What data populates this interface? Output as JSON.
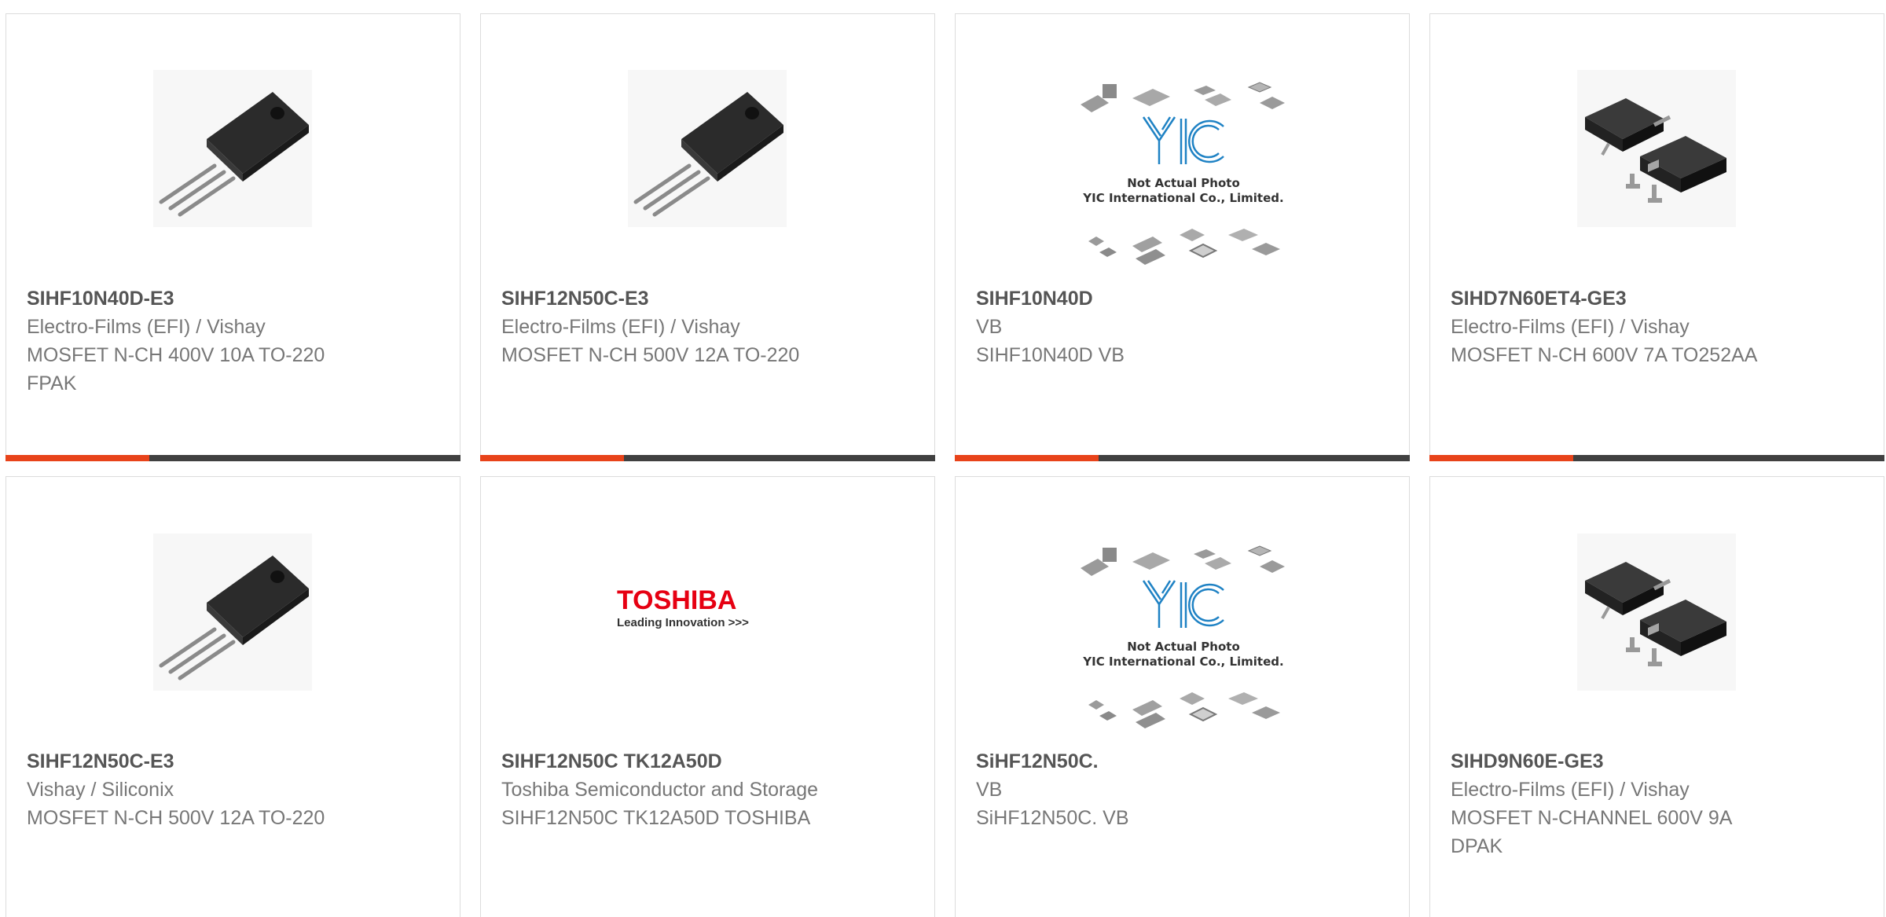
{
  "colors": {
    "accent": "#e8431a",
    "bar": "#404040",
    "part_text": "#555555",
    "meta_text": "#777777",
    "toshiba_red": "#e60012"
  },
  "products": [
    {
      "part": "SIHF10N40D-E3",
      "manufacturer": "Electro-Films (EFI) / Vishay",
      "description": "MOSFET N-CH 400V 10A TO-220 FPAK",
      "image": "to220-fpak-icon"
    },
    {
      "part": "SIHF12N50C-E3",
      "manufacturer": "Electro-Films (EFI) / Vishay",
      "description": "MOSFET N-CH 500V 12A TO-220",
      "image": "to220-fpak-icon"
    },
    {
      "part": "SIHF10N40D",
      "manufacturer": "VB",
      "description": "SIHF10N40D VB",
      "image": "yic-placeholder",
      "image_text": [
        "Not Actual Photo",
        "YIC International Co., Limited."
      ]
    },
    {
      "part": "SIHD7N60ET4-GE3",
      "manufacturer": "Electro-Films (EFI) / Vishay",
      "description": "MOSFET N-CH 600V 7A TO252AA",
      "image": "dpak-icon"
    },
    {
      "part": "SIHF12N50C-E3",
      "manufacturer": "Vishay / Siliconix",
      "description": "MOSFET N-CH 500V 12A TO-220",
      "image": "to220-fpak-icon"
    },
    {
      "part": "SIHF12N50C TK12A50D",
      "manufacturer": "Toshiba Semiconductor and Storage",
      "description": "SIHF12N50C TK12A50D TOSHIBA",
      "image": "toshiba-logo",
      "image_text": [
        "TOSHIBA",
        "Leading Innovation >>>"
      ]
    },
    {
      "part": "SiHF12N50C.",
      "manufacturer": "VB",
      "description": "SiHF12N50C. VB",
      "image": "yic-placeholder",
      "image_text": [
        "Not Actual Photo",
        "YIC International Co., Limited."
      ]
    },
    {
      "part": "SIHD9N60E-GE3",
      "manufacturer": "Electro-Films (EFI) / Vishay",
      "description": "MOSFET N-CHANNEL 600V 9A DPAK",
      "image": "dpak-icon"
    }
  ]
}
